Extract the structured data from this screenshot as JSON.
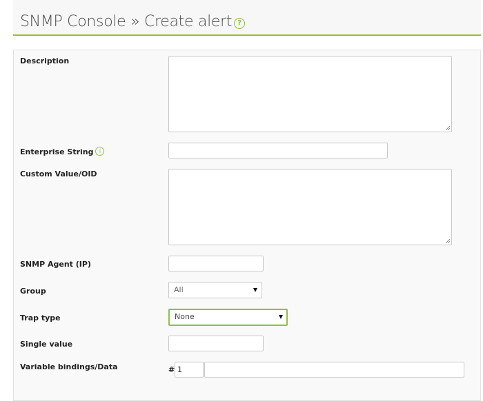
{
  "header": {
    "title": "SNMP Console » Create alert",
    "help_icon": "help-circle-icon",
    "accent_color": "#8fc041"
  },
  "form": {
    "description": {
      "label": "Description",
      "value": ""
    },
    "enterprise_string": {
      "label": "Enterprise String",
      "value": "",
      "info_icon": "info-icon"
    },
    "custom_value_oid": {
      "label": "Custom Value/OID",
      "value": ""
    },
    "snmp_agent": {
      "label": "SNMP Agent (IP)",
      "value": ""
    },
    "group": {
      "label": "Group",
      "selected": "All"
    },
    "trap_type": {
      "label": "Trap type",
      "selected": "None"
    },
    "single_value": {
      "label": "Single value",
      "value": ""
    },
    "variable_bindings": {
      "label": "Variable bindings/Data",
      "hash_symbol": "#",
      "index_value": "1",
      "data_value": ""
    }
  }
}
